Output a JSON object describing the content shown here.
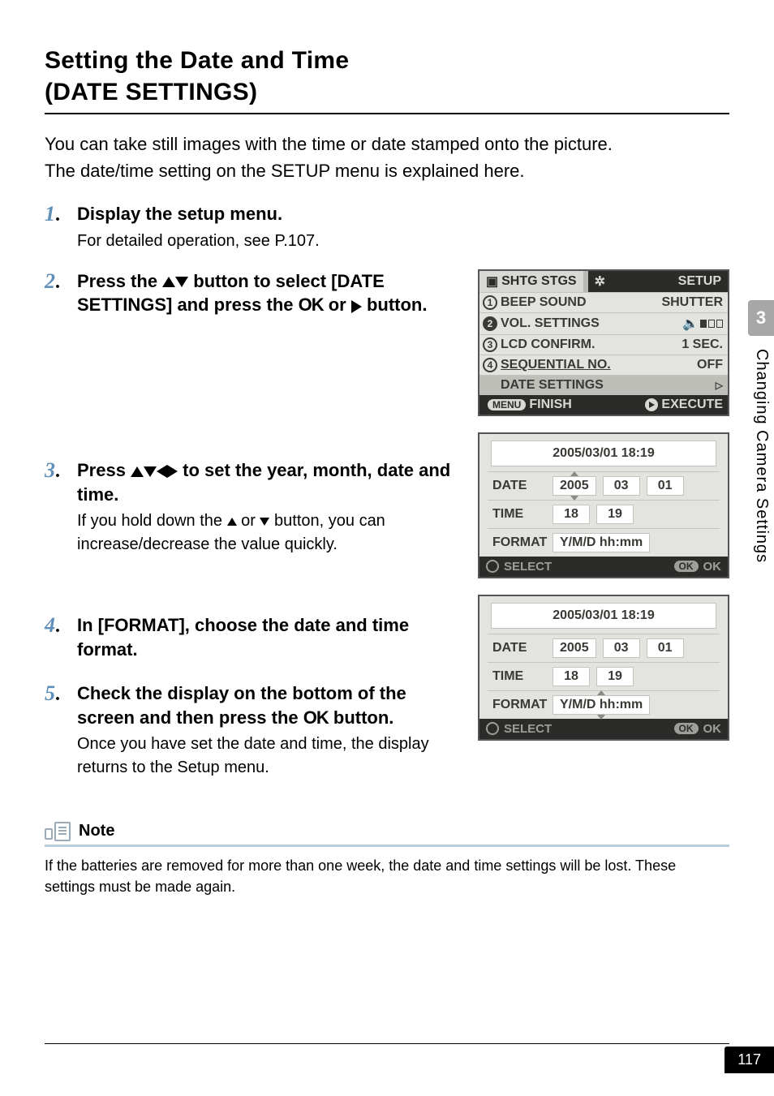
{
  "heading_line1": "Setting the Date and Time",
  "heading_line2": "(DATE SETTINGS)",
  "intro1": "You can take still images with the time or date stamped onto the picture.",
  "intro2": "The date/time setting on the SETUP menu is explained here.",
  "steps": {
    "s1": {
      "num": "1",
      "title": "Display the setup menu.",
      "desc": "For detailed operation, see P.107."
    },
    "s2": {
      "num": "2",
      "title_a": "Press the ",
      "title_b": " button to select [DATE SETTINGS] and press the ",
      "title_c": " or ",
      "title_d": " button."
    },
    "s3": {
      "num": "3",
      "title_a": "Press ",
      "title_b": " to set the year, month, date and time.",
      "desc_a": "If you hold down the ",
      "desc_b": " or ",
      "desc_c": " button, you can increase/decrease the value quickly."
    },
    "s4": {
      "num": "4",
      "title": "In [FORMAT], choose the date and time format."
    },
    "s5": {
      "num": "5",
      "title_a": "Check the display on the bottom of the screen and then press the ",
      "title_b": " button.",
      "desc": "Once you have set the date and time, the display returns to the Setup menu."
    }
  },
  "lcd_setup": {
    "tab1": "SHTG STGS",
    "tab2": "SETUP",
    "rows": {
      "r1": {
        "n": "1",
        "label": "BEEP SOUND",
        "val": "SHUTTER"
      },
      "r2": {
        "n": "2",
        "label": "VOL. SETTINGS"
      },
      "r3": {
        "n": "3",
        "label": "LCD CONFIRM.",
        "val": "1 SEC."
      },
      "r4": {
        "n": "4",
        "label": "SEQUENTIAL NO.",
        "val": "OFF"
      },
      "r5": {
        "label": "DATE SETTINGS"
      }
    },
    "foot_left": "FINISH",
    "foot_menu": "MENU",
    "foot_right": "EXECUTE"
  },
  "dlcd": {
    "title": "2005/03/01 18:19",
    "date_label": "DATE",
    "date_y": "2005",
    "date_m": "03",
    "date_d": "01",
    "time_label": "TIME",
    "time_h": "18",
    "time_m": "19",
    "fmt_label": "FORMAT",
    "fmt_val": "Y/M/D hh:mm",
    "foot_sel": "SELECT",
    "foot_ok_pill": "OK",
    "foot_ok": "OK"
  },
  "note_label": "Note",
  "note_text": "If the batteries are removed for more than one week, the date and time settings will be lost. These settings must be made again.",
  "side_tab": "3",
  "side_label": "Changing Camera Settings",
  "page_number": "117",
  "ok_text": "OK",
  "chart_data": {
    "type": "table",
    "setup_menu": [
      {
        "index": 1,
        "item": "BEEP SOUND",
        "value": "SHUTTER"
      },
      {
        "index": 2,
        "item": "VOL. SETTINGS",
        "value": "level 1 of 3"
      },
      {
        "index": 3,
        "item": "LCD CONFIRM.",
        "value": "1 SEC."
      },
      {
        "index": 4,
        "item": "SEQUENTIAL NO.",
        "value": "OFF"
      },
      {
        "index": 5,
        "item": "DATE SETTINGS",
        "value": "(selected)"
      }
    ],
    "date_settings_panel": {
      "current_display": "2005/03/01 18:19",
      "DATE": {
        "year": 2005,
        "month": 3,
        "day": 1,
        "active_field_screenshot2": "year"
      },
      "TIME": {
        "hour": 18,
        "minute": 19
      },
      "FORMAT": "Y/M/D hh:mm",
      "active_field_screenshot3": "FORMAT"
    }
  }
}
